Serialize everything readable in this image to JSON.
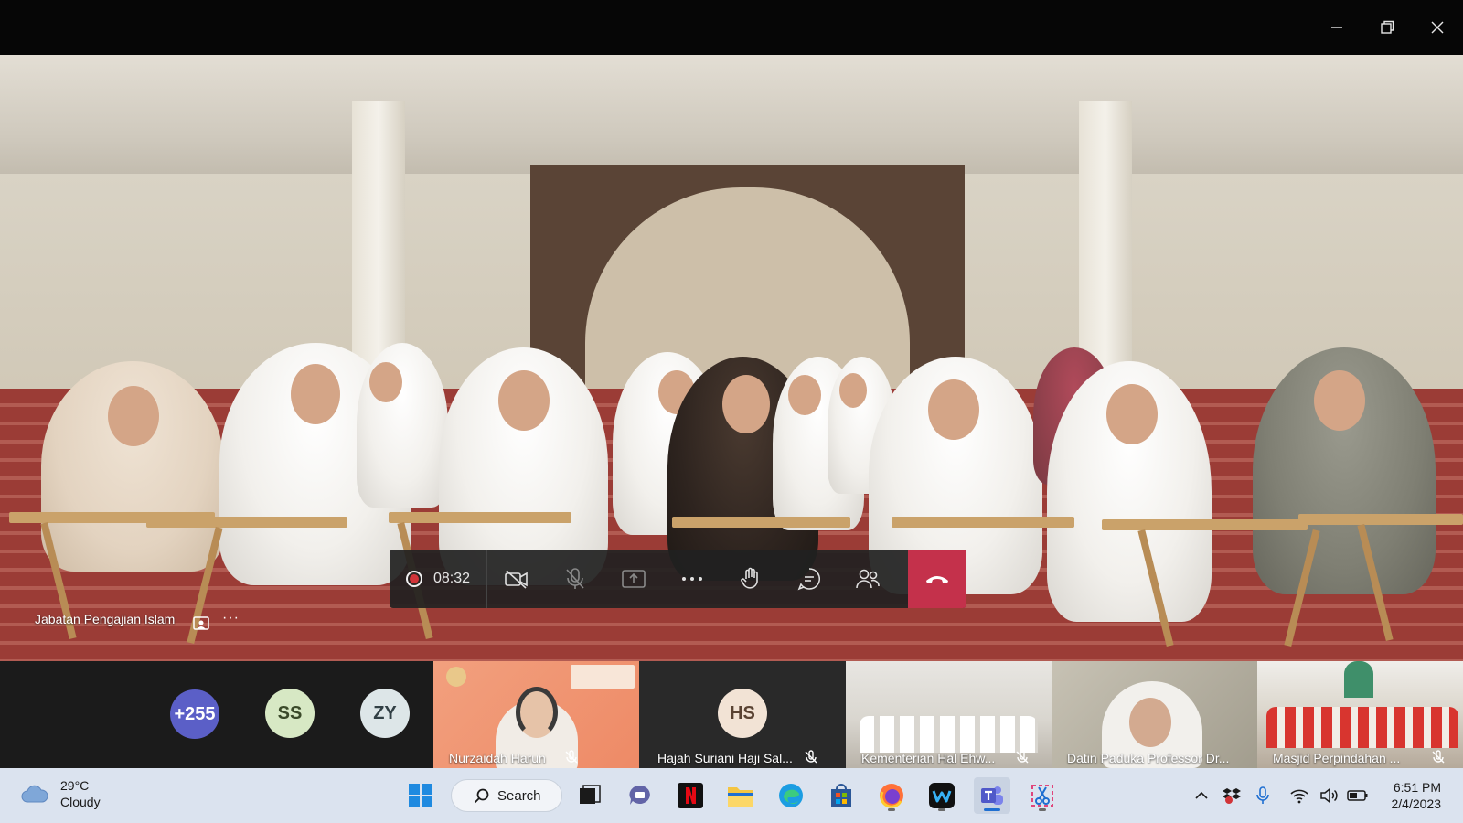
{
  "call": {
    "timer": "08:32",
    "main_speaker": "Jabatan Pengajian Islam",
    "more_symbol": "···"
  },
  "participants": {
    "overflow_count": "+255",
    "avatars": [
      {
        "initials": "SS",
        "color": "#d7e8c4",
        "text_color": "#3b4a2a"
      },
      {
        "initials": "ZY",
        "color": "#dde6e8",
        "text_color": "#324045"
      }
    ],
    "overflow_color": "#5b5fc7",
    "tiles": [
      {
        "name": "Nurzaidah Harun",
        "type": "video"
      },
      {
        "name": "Hajah Suriani Haji Sal...",
        "type": "initials",
        "initials": "HS"
      },
      {
        "name": "Kementerian Hal Ehw...",
        "type": "video"
      },
      {
        "name": "Datin Paduka Professor Dr...",
        "type": "video"
      },
      {
        "name": "Masjid Perpindahan ...",
        "type": "video"
      }
    ]
  },
  "taskbar": {
    "weather_temp": "29°C",
    "weather_desc": "Cloudy",
    "search_label": "Search",
    "time": "6:51 PM",
    "date": "2/4/2023"
  },
  "colors": {
    "hangup": "#c4314b",
    "recording": "#d13438",
    "teams_accent": "#5b5fc7"
  }
}
